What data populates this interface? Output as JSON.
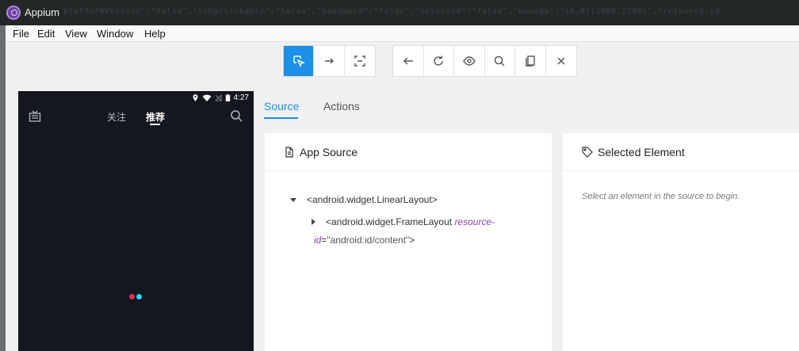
{
  "window": {
    "title": "Appium",
    "title_noise": "platformVersion\":\"false\",\"longclickable\":\"false\",\"password\":\"false\",\"selected\":\"false\",\"bounds\":\"[0,0][1080,2280]\",\"resource-id"
  },
  "menubar": {
    "items": [
      "File",
      "Edit",
      "View",
      "Window",
      "Help"
    ]
  },
  "toolbar": {
    "left_group": [
      {
        "icon": "select-elements-icon",
        "active": true
      },
      {
        "icon": "swipe-icon",
        "active": false
      },
      {
        "icon": "tap-icon",
        "active": false
      }
    ],
    "right_group": [
      {
        "icon": "back-icon"
      },
      {
        "icon": "refresh-icon"
      },
      {
        "icon": "eye-icon"
      },
      {
        "icon": "search-icon"
      },
      {
        "icon": "copy-icon"
      },
      {
        "icon": "close-icon"
      }
    ]
  },
  "device": {
    "status_time": "4:27",
    "tabs": [
      "关注",
      "推荐"
    ],
    "active_tab": "推荐"
  },
  "inspector": {
    "tabs": [
      "Source",
      "Actions"
    ],
    "active_tab": "Source"
  },
  "app_source": {
    "title": "App Source",
    "nodes": [
      {
        "text": "<android.widget.LinearLayout>",
        "expanded": true
      },
      {
        "tag_open": "<android.widget.FrameLayout ",
        "attr_name_1": "resource-",
        "attr_name_2": "id",
        "attr_eq": "=",
        "attr_value": "\"android:id/content\"",
        "tag_close": ">",
        "expanded": false
      }
    ]
  },
  "selected_element": {
    "title": "Selected Element",
    "placeholder": "Select an element in the source to begin."
  }
}
